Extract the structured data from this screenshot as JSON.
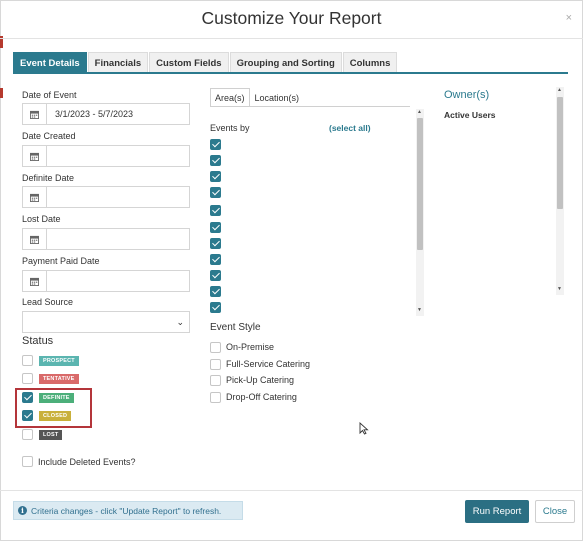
{
  "dialog": {
    "title": "Customize Your Report",
    "close_glyph": "×"
  },
  "tabs": [
    {
      "label": "Event Details",
      "active": true
    },
    {
      "label": "Financials",
      "active": false
    },
    {
      "label": "Custom Fields",
      "active": false
    },
    {
      "label": "Grouping and Sorting",
      "active": false
    },
    {
      "label": "Columns",
      "active": false
    }
  ],
  "left": {
    "date_of_event_label": "Date of Event",
    "date_of_event_value": "3/1/2023 - 5/7/2023",
    "date_created_label": "Date Created",
    "definite_date_label": "Definite Date",
    "lost_date_label": "Lost Date",
    "payment_paid_date_label": "Payment Paid Date",
    "lead_source_label": "Lead Source",
    "status_label": "Status",
    "statuses": [
      {
        "label": "PROSPECT",
        "checked": false,
        "color": "#5bb5b0"
      },
      {
        "label": "TENTATIVE",
        "checked": false,
        "color": "#d96a6a"
      },
      {
        "label": "DEFINITE",
        "checked": true,
        "color": "#4caf7a"
      },
      {
        "label": "CLOSED",
        "checked": true,
        "color": "#c9b03b"
      },
      {
        "label": "LOST",
        "checked": false,
        "color": "#555555"
      }
    ],
    "include_deleted_label": "Include Deleted Events?"
  },
  "middle": {
    "tab_area": "Area(s)",
    "tab_location": "Location(s)",
    "events_by_label": "Events by",
    "select_all": "(select all)",
    "event_checkbox_count": 11,
    "event_style_label": "Event Style",
    "event_styles": [
      "On-Premise",
      "Full-Service Catering",
      "Pick-Up Catering",
      "Drop-Off Catering"
    ]
  },
  "right": {
    "owners_title": "Owner(s)",
    "active_users_label": "Active Users"
  },
  "footer": {
    "info_text": "Criteria changes - click \"Update Report\" to refresh.",
    "run_report": "Run Report",
    "close": "Close"
  },
  "colors": {
    "accent": "#2b7a8e",
    "highlight_box": "#b4353a",
    "info_bg": "#dbeaf2"
  }
}
